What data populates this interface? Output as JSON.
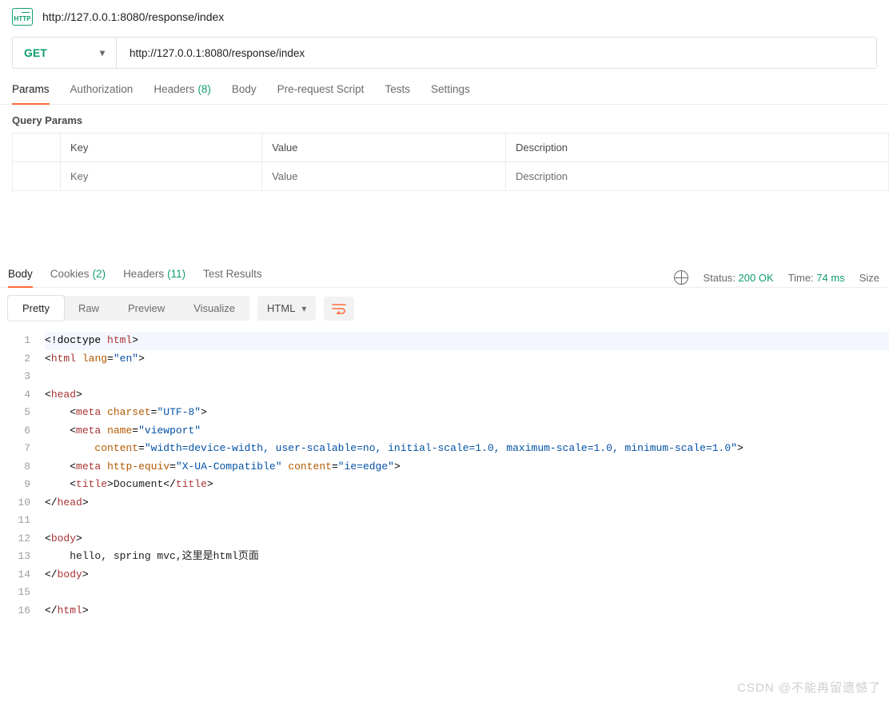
{
  "header": {
    "icon_text": "HTTP",
    "title": "http://127.0.0.1:8080/response/index"
  },
  "request": {
    "method": "GET",
    "url": "http://127.0.0.1:8080/response/index"
  },
  "req_tabs": {
    "params": "Params",
    "auth": "Authorization",
    "headers_label": "Headers",
    "headers_count": "(8)",
    "body": "Body",
    "prereq": "Pre-request Script",
    "tests": "Tests",
    "settings": "Settings"
  },
  "query_section": {
    "title": "Query Params",
    "headers": {
      "key": "Key",
      "value": "Value",
      "desc": "Description"
    },
    "placeholder": {
      "key": "Key",
      "value": "Value",
      "desc": "Description"
    }
  },
  "resp_tabs": {
    "body": "Body",
    "cookies_label": "Cookies",
    "cookies_count": "(2)",
    "headers_label": "Headers",
    "headers_count": "(11)",
    "tests": "Test Results"
  },
  "resp_meta": {
    "status_label": "Status:",
    "status_value": "200 OK",
    "time_label": "Time:",
    "time_value": "74 ms",
    "size_label": "Size"
  },
  "view": {
    "pretty": "Pretty",
    "raw": "Raw",
    "preview": "Preview",
    "visualize": "Visualize",
    "lang": "HTML"
  },
  "code_lines": [
    {
      "n": 1,
      "indent": 0,
      "segs": [
        [
          "br",
          "<"
        ],
        [
          "br",
          "!doctype "
        ],
        [
          "name",
          "html"
        ],
        [
          "br",
          ">"
        ]
      ],
      "hl": true
    },
    {
      "n": 2,
      "indent": 0,
      "segs": [
        [
          "br",
          "<"
        ],
        [
          "name",
          "html"
        ],
        [
          "plain",
          " "
        ],
        [
          "attr",
          "lang"
        ],
        [
          "eq",
          "="
        ],
        [
          "val",
          "\"en\""
        ],
        [
          "br",
          ">"
        ]
      ]
    },
    {
      "n": 3,
      "indent": 0,
      "segs": []
    },
    {
      "n": 4,
      "indent": 0,
      "segs": [
        [
          "br",
          "<"
        ],
        [
          "name",
          "head"
        ],
        [
          "br",
          ">"
        ]
      ]
    },
    {
      "n": 5,
      "indent": 1,
      "segs": [
        [
          "br",
          "<"
        ],
        [
          "name",
          "meta"
        ],
        [
          "plain",
          " "
        ],
        [
          "attr",
          "charset"
        ],
        [
          "eq",
          "="
        ],
        [
          "val",
          "\"UTF-8\""
        ],
        [
          "br",
          ">"
        ]
      ]
    },
    {
      "n": 6,
      "indent": 1,
      "segs": [
        [
          "br",
          "<"
        ],
        [
          "name",
          "meta"
        ],
        [
          "plain",
          " "
        ],
        [
          "attr",
          "name"
        ],
        [
          "eq",
          "="
        ],
        [
          "val",
          "\"viewport\""
        ]
      ]
    },
    {
      "n": 7,
      "indent": 2,
      "segs": [
        [
          "attr",
          "content"
        ],
        [
          "eq",
          "="
        ],
        [
          "val",
          "\"width=device-width, user-scalable=no, initial-scale=1.0, maximum-scale=1.0, minimum-scale=1.0\""
        ],
        [
          "br",
          ">"
        ]
      ]
    },
    {
      "n": 8,
      "indent": 1,
      "segs": [
        [
          "br",
          "<"
        ],
        [
          "name",
          "meta"
        ],
        [
          "plain",
          " "
        ],
        [
          "attr",
          "http-equiv"
        ],
        [
          "eq",
          "="
        ],
        [
          "val",
          "\"X-UA-Compatible\""
        ],
        [
          "plain",
          " "
        ],
        [
          "attr",
          "content"
        ],
        [
          "eq",
          "="
        ],
        [
          "val",
          "\"ie=edge\""
        ],
        [
          "br",
          ">"
        ]
      ]
    },
    {
      "n": 9,
      "indent": 1,
      "segs": [
        [
          "br",
          "<"
        ],
        [
          "name",
          "title"
        ],
        [
          "br",
          ">"
        ],
        [
          "plain",
          "Document"
        ],
        [
          "br",
          "</"
        ],
        [
          "name",
          "title"
        ],
        [
          "br",
          ">"
        ]
      ]
    },
    {
      "n": 10,
      "indent": 0,
      "segs": [
        [
          "br",
          "</"
        ],
        [
          "name",
          "head"
        ],
        [
          "br",
          ">"
        ]
      ]
    },
    {
      "n": 11,
      "indent": 0,
      "segs": []
    },
    {
      "n": 12,
      "indent": 0,
      "segs": [
        [
          "br",
          "<"
        ],
        [
          "name",
          "body"
        ],
        [
          "br",
          ">"
        ]
      ]
    },
    {
      "n": 13,
      "indent": 1,
      "segs": [
        [
          "plain",
          "hello, spring mvc,这里是html页面"
        ]
      ]
    },
    {
      "n": 14,
      "indent": 0,
      "segs": [
        [
          "br",
          "</"
        ],
        [
          "name",
          "body"
        ],
        [
          "br",
          ">"
        ]
      ]
    },
    {
      "n": 15,
      "indent": 0,
      "segs": []
    },
    {
      "n": 16,
      "indent": 0,
      "segs": [
        [
          "br",
          "</"
        ],
        [
          "name",
          "html"
        ],
        [
          "br",
          ">"
        ]
      ]
    }
  ],
  "watermark": "CSDN @不能再留遗憾了"
}
